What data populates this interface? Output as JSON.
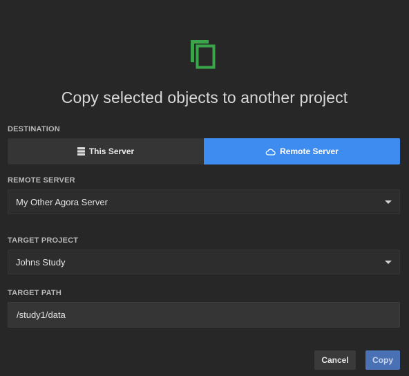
{
  "dialog": {
    "icon": "copy-icon",
    "icon_color": "#3aa54a",
    "title": "Copy selected objects to another project"
  },
  "destination": {
    "label": "DESTINATION",
    "options": [
      {
        "label": "This Server",
        "icon": "server-icon",
        "selected": false
      },
      {
        "label": "Remote Server",
        "icon": "cloud-icon",
        "selected": true
      }
    ],
    "accent_color": "#3f8cf0"
  },
  "remote_server": {
    "label": "REMOTE SERVER",
    "value": "My Other Agora Server"
  },
  "target_project": {
    "label": "TARGET PROJECT",
    "value": "Johns Study"
  },
  "target_path": {
    "label": "TARGET PATH",
    "value": "/study1/data"
  },
  "actions": {
    "cancel_label": "Cancel",
    "copy_label": "Copy"
  }
}
